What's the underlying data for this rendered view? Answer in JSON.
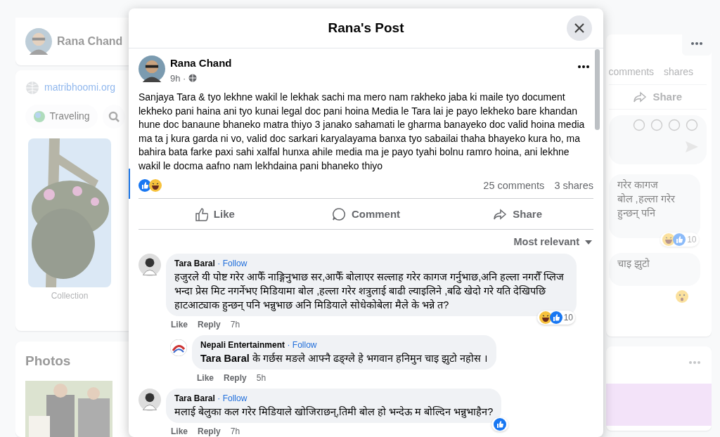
{
  "background": {
    "profile_name": "Rana Chand",
    "website": "matribhoomi.org",
    "chips": [
      {
        "label": "Traveling"
      }
    ],
    "featured_caption": "Collection",
    "photos_title": "Photos",
    "right": {
      "comments": "comments",
      "shares": "shares",
      "share": "Share",
      "comment_lines": [
        "गरेर कागज",
        "बोल ,हल्ला गरेर",
        "हुन्छन् पनि"
      ],
      "reaction_count": "10",
      "reply_line": "चाइ झुटो"
    }
  },
  "modal": {
    "title": "Rana's Post",
    "post": {
      "author": "Rana Chand",
      "time": "9h ·",
      "text": "Sanjaya Tara & tyo lekhne wakil le lekhak sachi ma mero nam rakheko jaba ki maile tyo document lekheko pani haina ani tyo kunai legal doc pani hoina Media le Tara lai je payo lekheko bare khandan hune doc banaune bhaneko matra thiyo 3 janako sahamati le gharma banayeko doc valid hoina media ma ta j kura garda ni vo, valid doc sarkari karyalayama banxa tyo sabailai thaha bhayeko kura ho, ma bahira bata farke paxi sahi xalfal hunxa ahile media ma je payo tyahi bolnu ramro hoina, ani lekhne wakil le docma aafno nam lekhdaina pani bhaneko thiyo",
      "comments_count": "25 comments",
      "shares_count": "3 shares",
      "actions": [
        {
          "kind": "like",
          "label": "Like"
        },
        {
          "kind": "comment",
          "label": "Comment"
        },
        {
          "kind": "share",
          "label": "Share"
        }
      ]
    },
    "sort": "Most relevant",
    "comments": [
      {
        "author": "Tara Baral",
        "follow": "· Follow",
        "text": "हजुरले यी पोष्ट गरेर आफैँ नाङ्गिनुभाछ सर,आफैँ बोलाएर सल्लाह गरेर कागज गर्नुभाछ,अनि हल्ला नगरौँ प्लिज भन्दा प्रेस मिट नगर्नेभए मिडियामा बोल ,हल्ला गरेर शत्रुलाई बाढी ल्याइलिने ,बढि खेदो गरे यति देखिपछि हाटआट्याक हुन्छन् पनि भन्नुभाछ अनि मिडियाले सोधेकोबेला मैले के भन्ने त?",
        "like": "Like",
        "reply": "Reply",
        "time": "7h",
        "reaction_count": "10",
        "children": [
          {
            "author": "Nepali Entertainment",
            "follow": "· Follow",
            "text": "**Tara Baral** के गर्छस मङले आफ्नै ढङ्ग्ले हे भगवान हनिमुन चाइ झुटो नहोस ।",
            "like": "Like",
            "reply": "Reply",
            "time": "5h"
          }
        ]
      },
      {
        "author": "Tara Baral",
        "follow": "· Follow",
        "text": "मलाई बेलुका कल गरेर मिडियाले खोजिराछन्,तिमी बोल हो भन्देऊ म बोल्दिन भन्नुभाहैन?",
        "like": "Like",
        "reply": "Reply",
        "time": "7h"
      }
    ]
  }
}
